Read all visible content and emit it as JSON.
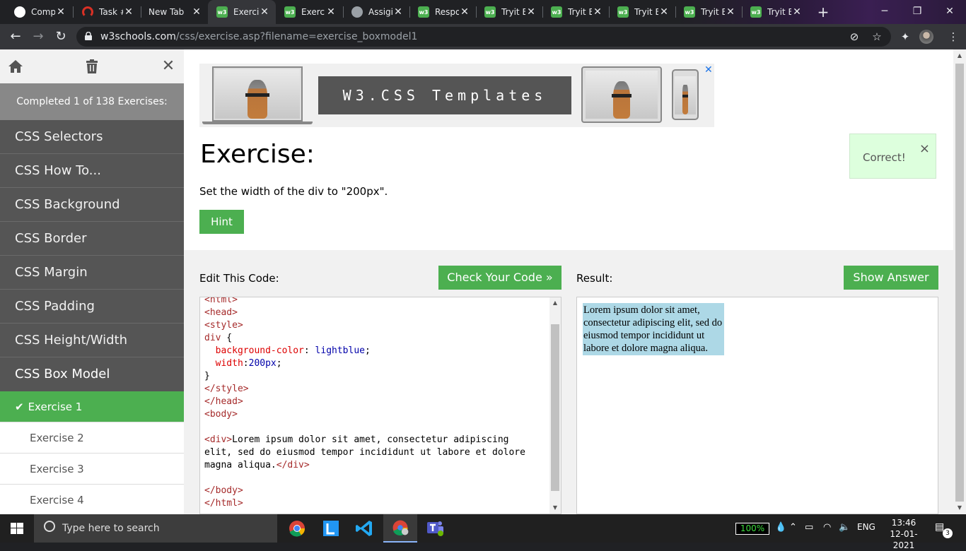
{
  "browser": {
    "tabs": [
      {
        "title": "Comp",
        "favicon": "github-icon"
      },
      {
        "title": "Task #",
        "favicon": "task-icon"
      },
      {
        "title": "New Tab",
        "favicon": "none"
      },
      {
        "title": "Exerci",
        "favicon": "w3schools-icon",
        "active": true
      },
      {
        "title": "Exerci",
        "favicon": "w3schools-icon"
      },
      {
        "title": "Assigi",
        "favicon": "globe-icon"
      },
      {
        "title": "Respo",
        "favicon": "w3schools-icon"
      },
      {
        "title": "Tryit E",
        "favicon": "w3schools-icon"
      },
      {
        "title": "Tryit E",
        "favicon": "w3schools-icon"
      },
      {
        "title": "Tryit E",
        "favicon": "w3schools-icon"
      },
      {
        "title": "Tryit E",
        "favicon": "w3schools-icon"
      },
      {
        "title": "Tryit E",
        "favicon": "w3schools-icon"
      }
    ],
    "url_host": "w3schools.com",
    "url_path": "/css/exercise.asp?filename=exercise_boxmodel1"
  },
  "sidebar": {
    "progress": "Completed 1 of 138 Exercises:",
    "categories": [
      "CSS Selectors",
      "CSS How To...",
      "CSS Background",
      "CSS Border",
      "CSS Margin",
      "CSS Padding",
      "CSS Height/Width",
      "CSS Box Model"
    ],
    "exercises": [
      "Exercise 1",
      "Exercise 2",
      "Exercise 3",
      "Exercise 4"
    ],
    "check_mark": "✔"
  },
  "ad": {
    "banner": "W3.CSS Templates",
    "close": "✕"
  },
  "exercise": {
    "title": "Exercise:",
    "description": "Set the width of the div to \"200px\".",
    "hint_label": "Hint",
    "correct_message": "Correct!",
    "correct_close": "×"
  },
  "editor": {
    "label": "Edit This Code:",
    "check_label": "Check Your Code »",
    "lines": {
      "l1": "<html>",
      "l2": "<head>",
      "l3": "<style>",
      "l4_sel": "div",
      "l4_brace": " {",
      "l5_prop": "background-color",
      "l5_val": "lightblue",
      "l6_prop": "width",
      "l6_val": "200px",
      "l7": "}",
      "l8": "</style>",
      "l9": "</head>",
      "l10": "<body>",
      "l12_open": "<div>",
      "l12_text": "Lorem ipsum dolor sit amet, consectetur adipiscing",
      "l13": "elit, sed do eiusmod tempor incididunt ut labore et dolore",
      "l14_text": "magna aliqua.",
      "l14_close": "</div>",
      "l16": "</body>",
      "l17": "</html>"
    }
  },
  "result": {
    "label": "Result:",
    "answer_label": "Show Answer",
    "div_text": "Lorem ipsum dolor sit amet, consectetur adipiscing elit, sed do eiusmod tempor incididunt ut labore et dolore magna aliqua."
  },
  "taskbar": {
    "search_placeholder": "Type here to search",
    "battery": "100%",
    "language": "ENG",
    "time": "13:46",
    "date": "12-01-2021",
    "notifications": "3"
  },
  "colors": {
    "w3_green": "#4CAF50",
    "sidebar_bg": "#555555",
    "result_div": "#add8e6"
  }
}
